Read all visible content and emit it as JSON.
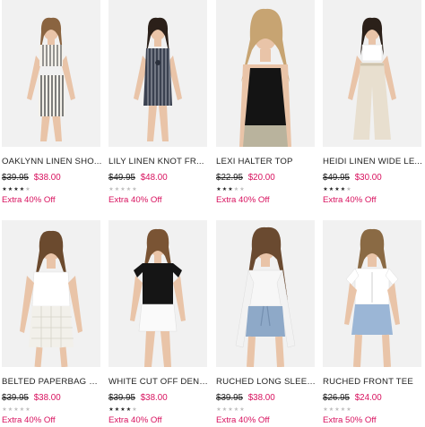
{
  "colors": {
    "accent": "#d8115e",
    "star_filled": "#222222",
    "star_empty": "#bdbdbd",
    "photo_bg": "#f1f1f1"
  },
  "products": [
    {
      "name": "OAKLYNN LINEN SHO...",
      "was": "$39.95",
      "now": "$38.00",
      "rating": 4,
      "promo": "Extra 40% Off",
      "image": "striped-linen-set"
    },
    {
      "name": "LILY LINEN KNOT FR...",
      "was": "$49.95",
      "now": "$48.00",
      "rating": 0,
      "promo": "Extra 40% Off",
      "image": "striped-knot-dress"
    },
    {
      "name": "LEXI HALTER TOP",
      "was": "$22.95",
      "now": "$20.00",
      "rating": 3,
      "promo": "Extra 40% Off",
      "image": "black-halter-top"
    },
    {
      "name": "HEIDI LINEN WIDE LE...",
      "was": "$49.95",
      "now": "$30.00",
      "rating": 4,
      "promo": "Extra 40% Off",
      "image": "linen-wide-leg-pants"
    },
    {
      "name": "BELTED PAPERBAG S...",
      "was": "$39.95",
      "now": "$38.00",
      "rating": 0,
      "promo": "Extra 40% Off",
      "image": "white-paperbag-shorts"
    },
    {
      "name": "WHITE CUT OFF DENI...",
      "was": "$39.95",
      "now": "$38.00",
      "rating": 4,
      "promo": "Extra 40% Off",
      "image": "white-denim-shorts"
    },
    {
      "name": "RUCHED LONG SLEEV...",
      "was": "$39.95",
      "now": "$38.00",
      "rating": 0,
      "promo": "Extra 40% Off",
      "image": "ruched-long-sleeve-top"
    },
    {
      "name": "RUCHED FRONT TEE",
      "was": "$26.95",
      "now": "$24.00",
      "rating": 0,
      "promo": "Extra 50% Off",
      "image": "ruched-front-tee"
    }
  ]
}
